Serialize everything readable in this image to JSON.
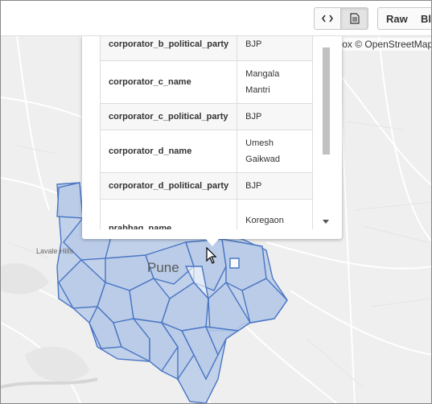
{
  "toolbar": {
    "code_icon": "code-icon",
    "doc_icon": "document-icon",
    "raw_label": "Raw",
    "blame_label": "Bl"
  },
  "attribution": {
    "copyright": "©",
    "mapbox": "Mapbox",
    "osm": "© OpenStreetMap"
  },
  "popup": {
    "rows": [
      {
        "key": "corporator_b_political_party",
        "value": "BJP"
      },
      {
        "key": "corporator_c_name",
        "value": "Mangala Mantri"
      },
      {
        "key": "corporator_c_political_party",
        "value": "BJP"
      },
      {
        "key": "corporator_d_name",
        "value": "Umesh Gaikwad"
      },
      {
        "key": "corporator_d_political_party",
        "value": "BJP"
      },
      {
        "key": "prabhag_name",
        "value": "Koregaon Park-Ghorpadi"
      }
    ]
  },
  "map_labels": {
    "city": "Pune",
    "hill": "Lavale Hills"
  },
  "colors": {
    "ward_fill": "#b9cbe8",
    "ward_stroke": "#4a76c4",
    "map_bg": "#f1f1f1",
    "roads": "#ffffff"
  }
}
